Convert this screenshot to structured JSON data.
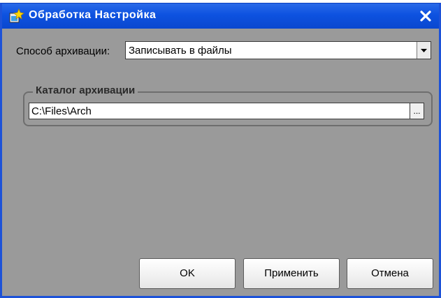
{
  "window": {
    "title": "Обработка  Настройка",
    "accent_color": "#0d52e0",
    "background_color": "#9a9a9a",
    "title_icon": "processing-icon",
    "close_icon": "close-icon"
  },
  "archive_method": {
    "label": "Способ архивации:",
    "value": "Записывать в файлы",
    "dropdown_icon": "chevron-down-icon"
  },
  "archive_directory": {
    "group_title": "Каталог архивации",
    "path": "C:\\Files\\Arch",
    "browse_label": "..."
  },
  "buttons": {
    "ok": "OK",
    "apply": "Применить",
    "cancel": "Отмена"
  }
}
